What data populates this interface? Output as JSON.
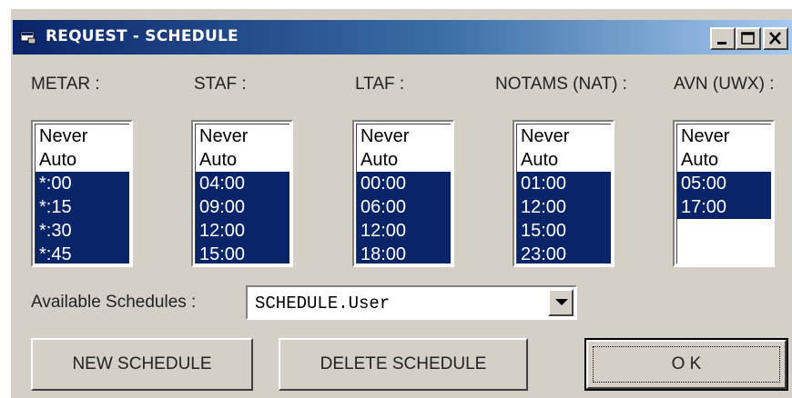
{
  "window": {
    "title": "REQUEST - SCHEDULE"
  },
  "columns": [
    {
      "label": "METAR :",
      "options": [
        "Never",
        "Auto",
        "*:00",
        "*:15",
        "*:30",
        "*:45"
      ],
      "selected": [
        2,
        3,
        4,
        5
      ]
    },
    {
      "label": "STAF :",
      "options": [
        "Never",
        "Auto",
        "04:00",
        "09:00",
        "12:00",
        "15:00"
      ],
      "selected": [
        2,
        3,
        4,
        5
      ]
    },
    {
      "label": "LTAF :",
      "options": [
        "Never",
        "Auto",
        "00:00",
        "06:00",
        "12:00",
        "18:00"
      ],
      "selected": [
        2,
        3,
        4,
        5
      ]
    },
    {
      "label": "NOTAMS (NAT) :",
      "options": [
        "Never",
        "Auto",
        "01:00",
        "12:00",
        "15:00",
        "23:00"
      ],
      "selected": [
        2,
        3,
        4,
        5
      ]
    },
    {
      "label": "AVN (UWX) :",
      "options": [
        "Never",
        "Auto",
        "05:00",
        "17:00"
      ],
      "selected": [
        2,
        3
      ]
    }
  ],
  "schedules": {
    "label": "Available Schedules :",
    "value": "SCHEDULE.User"
  },
  "buttons": {
    "new": "NEW SCHEDULE",
    "delete": "DELETE SCHEDULE",
    "ok": "O K"
  },
  "colors": {
    "selection": "#0a246a",
    "face": "#d4d0c8"
  }
}
